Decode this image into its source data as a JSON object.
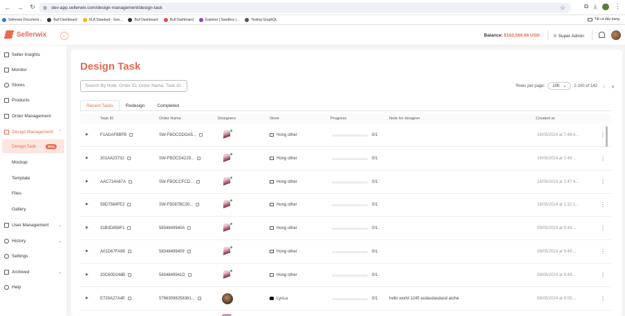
{
  "browser": {
    "url": "dev-app.sellerwix.com/design-management/design-task",
    "bookmarks": [
      "Sellerwix Document...",
      "Bull Dashboard",
      "SLA Standard - Goo...",
      "Bull Dashboard",
      "Bull Dashboard",
      "Explorer | Sandbox |...",
      "Testing GraphQL"
    ],
    "bookmark_colors": [
      "#3a78d8",
      "#333333",
      "#f4b400",
      "#333333",
      "#d9534f",
      "#8e44ad",
      "#555555"
    ],
    "all_bookmarks": "Tất cả dấu trang"
  },
  "header": {
    "logo": "Sellerwix",
    "balance_label": "Balance:",
    "balance_value": "$182,568.66 USD",
    "role": "Super Admin"
  },
  "sidebar": {
    "items": [
      {
        "label": "Seller Insights",
        "icon": "chart-icon"
      },
      {
        "label": "Monitor",
        "icon": "monitor-icon"
      },
      {
        "label": "Stores",
        "icon": "store-icon"
      },
      {
        "label": "Products",
        "icon": "products-icon"
      },
      {
        "label": "Order Management",
        "icon": "order-icon"
      },
      {
        "label": "Design Management",
        "icon": "design-icon",
        "expanded": true
      },
      {
        "label": "User Management",
        "icon": "users-icon"
      },
      {
        "label": "History",
        "icon": "history-icon"
      },
      {
        "label": "Settings",
        "icon": "settings-icon"
      },
      {
        "label": "Archived",
        "icon": "archive-icon"
      },
      {
        "label": "Help",
        "icon": "help-icon"
      }
    ],
    "design_sub": [
      {
        "label": "Design Task",
        "badge": "Beta",
        "active": true
      },
      {
        "label": "Mockup"
      },
      {
        "label": "Template"
      },
      {
        "label": "Files"
      },
      {
        "label": "Gallery"
      }
    ]
  },
  "main": {
    "title": "Design Task",
    "search_placeholder": "Search By Note, Order ID, Order Name, Task ID",
    "rows_per_page_label": "Rows per page:",
    "rows_per_page_value": "100",
    "range": "1-100 of 142",
    "tabs": [
      "Recent Tasks",
      "Redesign",
      "Completed"
    ],
    "columns": [
      "Task ID",
      "Order Name",
      "Designers",
      "Store",
      "Progress",
      "Note for designer",
      "Created at"
    ],
    "rows": [
      {
        "task_id": "F1ADAF8BFB",
        "order_name": "SW-FBOCDDOA5...",
        "designer": "pink",
        "store": "Hong other",
        "store_icon": "store",
        "progress": "0/1",
        "progress_value": 0,
        "note": "",
        "created": "16/05/2024 at 7:48:4..."
      },
      {
        "task_id": "301AA23732",
        "order_name": "SW-FBOCD4229...",
        "designer": "pink",
        "store": "Hong other",
        "store_icon": "store",
        "progress": "0/1",
        "progress_value": 0,
        "note": "",
        "created": "16/05/2024 at 2:48:..."
      },
      {
        "task_id": "AAC714A67A",
        "order_name": "SW-FBOCCFCD...",
        "designer": "pink",
        "store": "Hong other",
        "store_icon": "store",
        "progress": "0/1",
        "progress_value": 0,
        "note": "",
        "created": "16/05/2024 at 2:47:4..."
      },
      {
        "task_id": "59D7584FE2",
        "order_name": "SW-FB087BC30...",
        "designer": "pink",
        "store": "Hong other",
        "store_icon": "store",
        "progress": "0/1",
        "progress_value": 0,
        "note": "",
        "created": "16/05/2024 at 1:32:1..."
      },
      {
        "task_id": "31B3D858F1",
        "order_name": "5834849940A",
        "designer": "pink",
        "store": "Hong other",
        "store_icon": "store",
        "progress": "0/1",
        "progress_value": 0,
        "note": "",
        "created": "09/05/2024 at 9:49:..."
      },
      {
        "task_id": "A01D67FA99",
        "order_name": "58348499409",
        "designer": "pink",
        "store": "Hong other",
        "store_icon": "store",
        "progress": "0/1",
        "progress_value": 0,
        "note": "",
        "created": "09/05/2024 at 9:49:..."
      },
      {
        "task_id": "20C60D248B",
        "order_name": "5834849941D",
        "designer": "pink",
        "store": "Hong other",
        "store_icon": "store",
        "progress": "0/1",
        "progress_value": 0,
        "note": "",
        "created": "09/05/2024 at 9:49:..."
      },
      {
        "task_id": "E733A27A4E",
        "order_name": "57663098258381...",
        "designer": "photo",
        "store": "LynLa",
        "store_icon": "tiktok",
        "progress": "0/1",
        "progress_value": 0,
        "note": "hello world 1245 asdasdasdasd aloha",
        "created": "08/05/2024 at 8:05:..."
      }
    ]
  },
  "colors": {
    "accent": "#e8694f",
    "active_bg": "#fde6df",
    "online": "#3bb54a"
  }
}
